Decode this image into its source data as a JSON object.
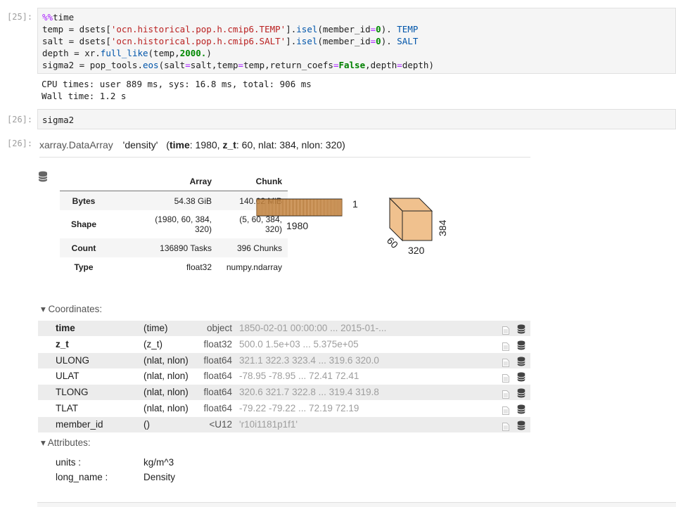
{
  "cells": {
    "c25": {
      "in_prompt": "[25]:",
      "code": [
        [
          [
            "kw-magic",
            "%%"
          ],
          [
            "",
            "time"
          ]
        ],
        [
          [
            "",
            "temp = dsets["
          ],
          [
            "str",
            "'ocn.historical.pop.h.cmip6.TEMP'"
          ],
          [
            "",
            "]."
          ],
          [
            "attr",
            "isel"
          ],
          [
            "",
            "(member_id"
          ],
          [
            "op",
            "="
          ],
          [
            "num",
            "0"
          ],
          [
            "",
            "). "
          ],
          [
            "attr",
            "TEMP"
          ]
        ],
        [
          [
            "",
            "salt = dsets["
          ],
          [
            "str",
            "'ocn.historical.pop.h.cmip6.SALT'"
          ],
          [
            "",
            "]."
          ],
          [
            "attr",
            "isel"
          ],
          [
            "",
            "(member_id"
          ],
          [
            "op",
            "="
          ],
          [
            "num",
            "0"
          ],
          [
            "",
            "). "
          ],
          [
            "attr",
            "SALT"
          ]
        ],
        [
          [
            "",
            "depth = xr."
          ],
          [
            "attr",
            "full_like"
          ],
          [
            "",
            "(temp,"
          ],
          [
            "num",
            "2000."
          ],
          [
            "",
            ")"
          ]
        ],
        [
          [
            "",
            "sigma2 = pop_tools."
          ],
          [
            "attr",
            "eos"
          ],
          [
            "",
            "(salt"
          ],
          [
            "op",
            "="
          ],
          [
            "",
            "salt,temp"
          ],
          [
            "op",
            "="
          ],
          [
            "",
            "temp,return_coefs"
          ],
          [
            "op",
            "="
          ],
          [
            "kwbool",
            "False"
          ],
          [
            "",
            ",depth"
          ],
          [
            "op",
            "="
          ],
          [
            "",
            "depth)"
          ]
        ]
      ],
      "out_lines": [
        "CPU times: user 889 ms, sys: 16.8 ms, total: 906 ms",
        "Wall time: 1.2 s"
      ]
    },
    "c26_in": {
      "in_prompt": "[26]:",
      "code": "sigma2"
    },
    "c26_out": {
      "out_prompt": "[26]:"
    }
  },
  "dataarray": {
    "class": "xarray.DataArray",
    "name": "'density'",
    "dims_open": "(",
    "dims": [
      {
        "name": "time",
        "size": ": 1980, "
      },
      {
        "name": "z_t",
        "size": ": 60, "
      },
      {
        "plain": "nlat: 384, nlon: 320"
      }
    ],
    "dims_close": ")"
  },
  "dask_table": {
    "headers": [
      "",
      "Array",
      "Chunk"
    ],
    "rows": [
      {
        "label": "Bytes",
        "array": "54.38 GiB",
        "chunk": "140.62 MiB"
      },
      {
        "label": "Shape",
        "array": [
          "(1980, 60, 384,",
          "320)"
        ],
        "chunk": [
          "(5, 60, 384,",
          "320)"
        ]
      },
      {
        "label": "Count",
        "array": "136890 Tasks",
        "chunk": "396 Chunks"
      },
      {
        "label": "Type",
        "array": "float32",
        "chunk": "numpy.ndarray"
      }
    ]
  },
  "dask_viz": {
    "bar_label_x": "1980",
    "bar_label_y": "1",
    "cube_label_depth": "60",
    "cube_label_width": "320",
    "cube_label_height": "384"
  },
  "sections": {
    "coords_title": "Coordinates:",
    "attrs_title": "Attributes:"
  },
  "coordinates": [
    {
      "name": "time",
      "bold": true,
      "dims": "(time)",
      "dtype": "object",
      "preview": "1850-02-01 00:00:00 ... 2015-01-..."
    },
    {
      "name": "z_t",
      "bold": true,
      "dims": "(z_t)",
      "dtype": "float32",
      "preview": "500.0 1.5e+03 ... 5.375e+05"
    },
    {
      "name": "ULONG",
      "bold": false,
      "dims": "(nlat, nlon)",
      "dtype": "float64",
      "preview": "321.1 322.3 323.4 ... 319.6 320.0"
    },
    {
      "name": "ULAT",
      "bold": false,
      "dims": "(nlat, nlon)",
      "dtype": "float64",
      "preview": "-78.95 -78.95 ... 72.41 72.41"
    },
    {
      "name": "TLONG",
      "bold": false,
      "dims": "(nlat, nlon)",
      "dtype": "float64",
      "preview": "320.6 321.7 322.8 ... 319.4 319.8"
    },
    {
      "name": "TLAT",
      "bold": false,
      "dims": "(nlat, nlon)",
      "dtype": "float64",
      "preview": "-79.22 -79.22 ... 72.19 72.19"
    },
    {
      "name": "member_id",
      "bold": false,
      "dims": "()",
      "dtype": "<U12",
      "preview": "'r10i1181p1f1'"
    }
  ],
  "attributes": [
    {
      "key": "units :",
      "value": "kg/m^3"
    },
    {
      "key": "long_name :",
      "value": "Density"
    }
  ],
  "colors": {
    "chunk_fill": "#ECB172",
    "chunk_stroke": "#8B4903"
  }
}
